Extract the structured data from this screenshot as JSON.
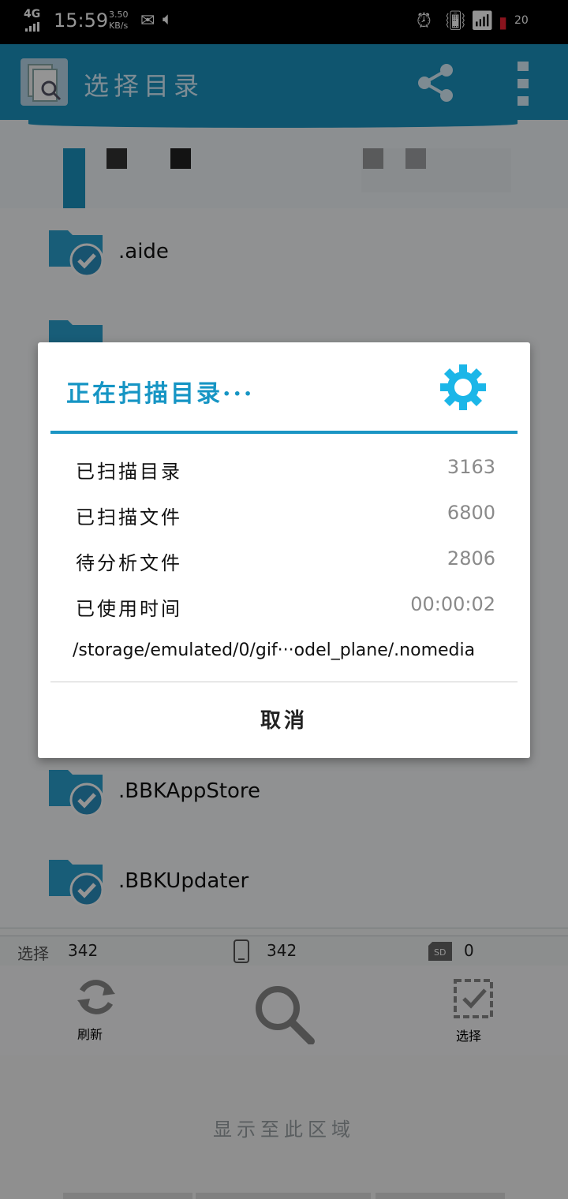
{
  "status_bar": {
    "network": "4G",
    "time": "15:59",
    "speed_value": "3.50",
    "speed_unit": "KB/s",
    "battery": "20"
  },
  "app_bar": {
    "title": "选择目录"
  },
  "folders": [
    {
      "name": ".aide"
    },
    {
      "name": ".BBKAppStore"
    },
    {
      "name": ".BBKUpdater"
    }
  ],
  "scan_dialog": {
    "title": "正在扫描目录···",
    "stats": [
      {
        "label": "已扫描目录",
        "value": "3163"
      },
      {
        "label": "已扫描文件",
        "value": "6800"
      },
      {
        "label": "待分析文件",
        "value": "2806"
      },
      {
        "label": "已使用时间",
        "value": "00:00:02"
      }
    ],
    "current_path": "/storage/emulated/0/gif···odel_plane/.nomedia",
    "cancel_label": "取消"
  },
  "count_bar": {
    "selected_label": "选择",
    "selected_count": "342",
    "phone_count": "342",
    "sd_count": "0"
  },
  "toolbar": {
    "refresh_label": "刷新",
    "select_label": "选择"
  },
  "ad": {
    "text": "显示至此区域"
  },
  "colors": {
    "accent": "#1b93c0",
    "gear": "#1bb6e8"
  }
}
